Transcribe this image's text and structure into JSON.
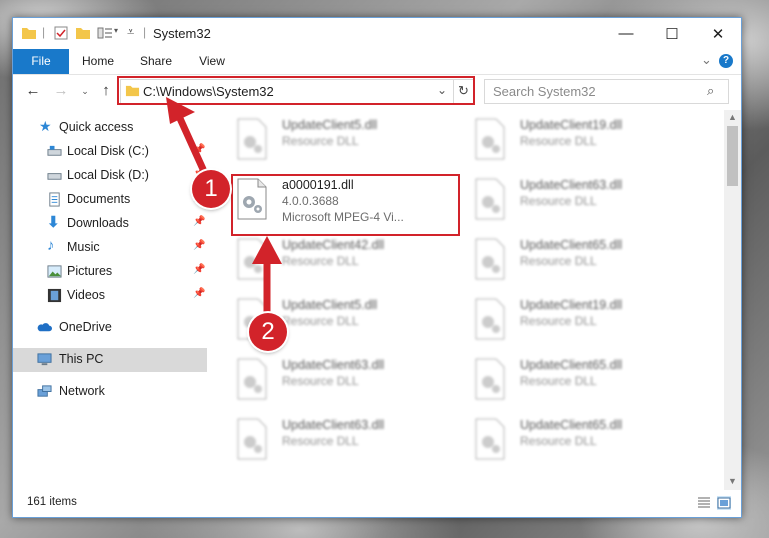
{
  "window": {
    "title": "System32"
  },
  "controls": {
    "minimize": "—",
    "maximize": "☐",
    "close": "✕"
  },
  "ribbon": {
    "tabs": [
      "File",
      "Home",
      "Share",
      "View"
    ],
    "expand": "⌄",
    "help": "?"
  },
  "address": {
    "path": "C:\\Windows\\System32"
  },
  "search": {
    "placeholder": "Search System32"
  },
  "sidebar": {
    "items": [
      {
        "label": "Quick access",
        "icon": "star-icon"
      },
      {
        "label": "Local Disk (C:)",
        "icon": "drive-icon"
      },
      {
        "label": "Local Disk (D:)",
        "icon": "drive-icon"
      },
      {
        "label": "Documents",
        "icon": "documents-icon"
      },
      {
        "label": "Downloads",
        "icon": "download-icon"
      },
      {
        "label": "Music",
        "icon": "music-icon"
      },
      {
        "label": "Pictures",
        "icon": "pictures-icon"
      },
      {
        "label": "Videos",
        "icon": "videos-icon"
      },
      {
        "label": "OneDrive",
        "icon": "cloud-icon"
      },
      {
        "label": "This PC",
        "icon": "computer-icon"
      },
      {
        "label": "Network",
        "icon": "network-icon"
      }
    ]
  },
  "files": {
    "selected": {
      "name": "a0000191.dll",
      "version": "4.0.0.3688",
      "description": "Microsoft MPEG-4 Vi..."
    },
    "others": [
      {
        "name": "UpdateClient5.dll",
        "type": "Resource DLL"
      },
      {
        "name": "UpdateClient19.dll",
        "type": "Resource DLL"
      },
      {
        "name": "UpdateClient63.dll",
        "type": "Resource DLL"
      },
      {
        "name": "UpdateClient42.dll",
        "type": "Resource DLL"
      },
      {
        "name": "UpdateClient65.dll",
        "type": "Resource DLL"
      },
      {
        "name": "UpdateClient5.dll",
        "type": "Resource DLL"
      },
      {
        "name": "UpdateClient19.dll",
        "type": "Resource DLL"
      },
      {
        "name": "UpdateClient63.dll",
        "type": "Resource DLL"
      },
      {
        "name": "UpdateClient65.dll",
        "type": "Resource DLL"
      },
      {
        "name": "UpdateClient63.dll",
        "type": "Resource DLL"
      },
      {
        "name": "UpdateClient65.dll",
        "type": "Resource DLL"
      }
    ]
  },
  "status": {
    "count": "161 items"
  },
  "annotations": {
    "step1": "1",
    "step2": "2",
    "color": "#d2232a"
  },
  "colors": {
    "accent": "#1979ca",
    "highlight": "#d2232a"
  }
}
